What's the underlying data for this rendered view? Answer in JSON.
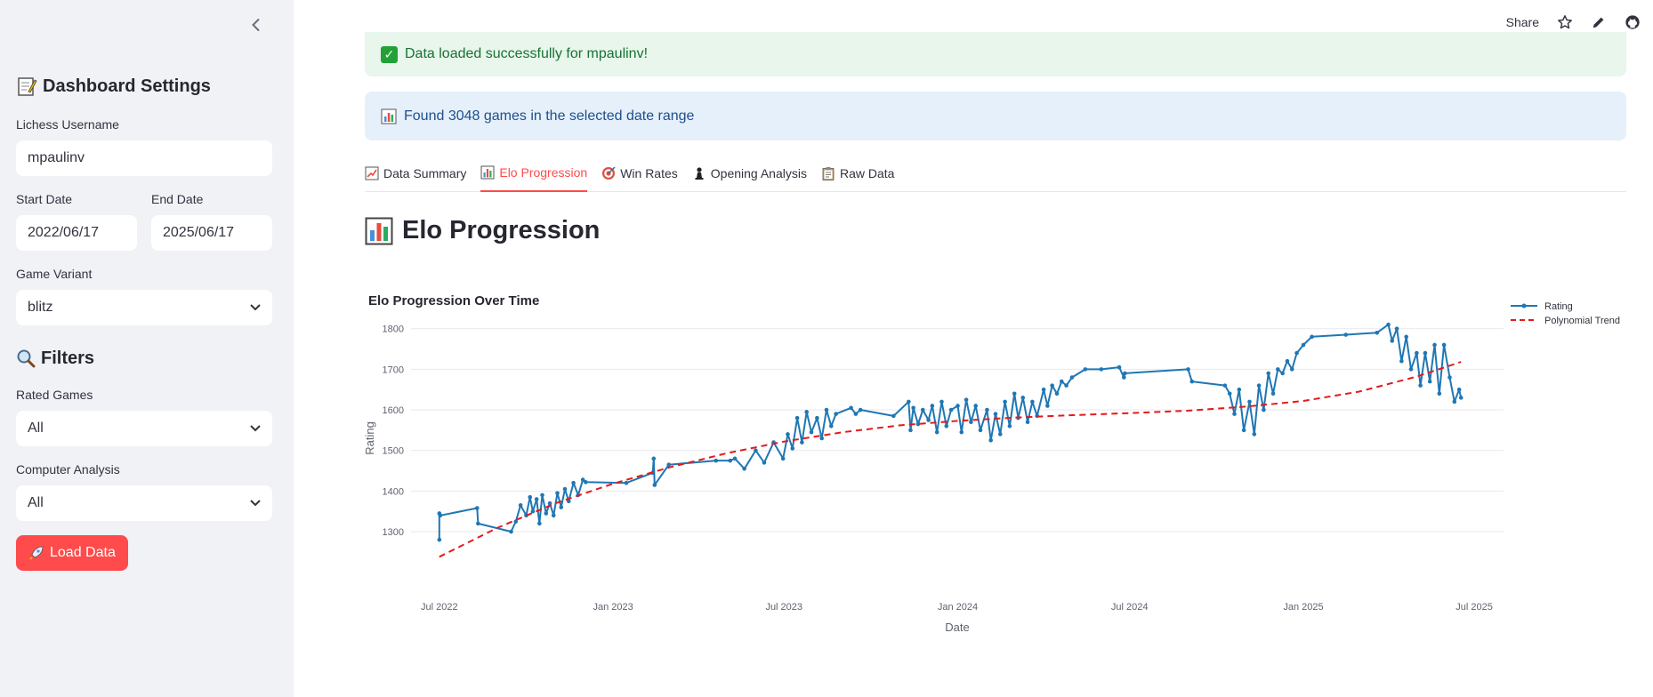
{
  "sidebar": {
    "heading": "Dashboard Settings",
    "username_label": "Lichess Username",
    "username_value": "mpaulinv",
    "start_date_label": "Start Date",
    "start_date_value": "2022/06/17",
    "end_date_label": "End Date",
    "end_date_value": "2025/06/17",
    "variant_label": "Game Variant",
    "variant_value": "blitz",
    "filters_heading": "Filters",
    "rated_label": "Rated Games",
    "rated_value": "All",
    "analysis_label": "Computer Analysis",
    "analysis_value": "All",
    "load_button": "Load Data"
  },
  "topbar": {
    "share_label": "Share"
  },
  "alerts": {
    "success": "Data loaded successfully for mpaulinv!",
    "info": "Found 3048 games in the selected date range"
  },
  "tabs": [
    {
      "label": "Data Summary",
      "icon": "chart-up-icon"
    },
    {
      "label": "Elo Progression",
      "icon": "bar-chart-icon",
      "active": true
    },
    {
      "label": "Win Rates",
      "icon": "target-icon"
    },
    {
      "label": "Opening Analysis",
      "icon": "pawn-icon"
    },
    {
      "label": "Raw Data",
      "icon": "clipboard-icon"
    }
  ],
  "page_title": "Elo Progression",
  "colors": {
    "accent": "#ff4b4b",
    "rating_line": "#1f77b4",
    "trend_line": "#e31a1c"
  },
  "chart_data": {
    "type": "line",
    "title": "Elo Progression Over Time",
    "xlabel": "Date",
    "ylabel": "Rating",
    "x_ticks": [
      "Jul 2022",
      "Jan 2023",
      "Jul 2023",
      "Jan 2024",
      "Jul 2024",
      "Jan 2025",
      "Jul 2025"
    ],
    "y_ticks": [
      1300,
      1400,
      1500,
      1600,
      1700,
      1800
    ],
    "xlim": [
      "2022-06-01",
      "2025-08-01"
    ],
    "ylim": [
      1230,
      1830
    ],
    "grid": true,
    "legend_position": "top-right",
    "series": [
      {
        "name": "Rating",
        "style": "line+markers",
        "x": [
          "2022-07-01",
          "2022-07-01",
          "2022-07-02",
          "2022-08-10",
          "2022-08-11",
          "2022-09-15",
          "2022-09-20",
          "2022-09-25",
          "2022-10-01",
          "2022-10-05",
          "2022-10-08",
          "2022-10-12",
          "2022-10-15",
          "2022-10-18",
          "2022-10-22",
          "2022-10-26",
          "2022-10-30",
          "2022-11-03",
          "2022-11-07",
          "2022-11-11",
          "2022-11-15",
          "2022-11-20",
          "2022-11-25",
          "2022-11-30",
          "2022-12-03",
          "2023-01-15",
          "2023-02-12",
          "2023-02-13",
          "2023-02-14",
          "2023-03-01",
          "2023-04-20",
          "2023-05-05",
          "2023-05-10",
          "2023-05-20",
          "2023-06-01",
          "2023-06-10",
          "2023-06-20",
          "2023-06-30",
          "2023-07-05",
          "2023-07-10",
          "2023-07-15",
          "2023-07-20",
          "2023-07-25",
          "2023-07-30",
          "2023-08-05",
          "2023-08-10",
          "2023-08-15",
          "2023-08-20",
          "2023-08-25",
          "2023-09-10",
          "2023-09-15",
          "2023-09-20",
          "2023-10-25",
          "2023-11-10",
          "2023-11-12",
          "2023-11-15",
          "2023-11-20",
          "2023-11-25",
          "2023-12-01",
          "2023-12-05",
          "2023-12-10",
          "2023-12-15",
          "2023-12-20",
          "2023-12-25",
          "2024-01-01",
          "2024-01-05",
          "2024-01-10",
          "2024-01-15",
          "2024-01-20",
          "2024-01-25",
          "2024-02-01",
          "2024-02-05",
          "2024-02-10",
          "2024-02-15",
          "2024-02-20",
          "2024-02-25",
          "2024-03-01",
          "2024-03-05",
          "2024-03-10",
          "2024-03-15",
          "2024-03-20",
          "2024-03-25",
          "2024-04-01",
          "2024-04-05",
          "2024-04-10",
          "2024-04-15",
          "2024-04-20",
          "2024-04-25",
          "2024-05-01",
          "2024-05-15",
          "2024-06-01",
          "2024-06-20",
          "2024-06-25",
          "2024-06-26",
          "2024-09-01",
          "2024-09-05",
          "2024-10-10",
          "2024-10-15",
          "2024-10-20",
          "2024-10-25",
          "2024-10-30",
          "2024-11-05",
          "2024-11-10",
          "2024-11-15",
          "2024-11-20",
          "2024-11-25",
          "2024-11-30",
          "2024-12-05",
          "2024-12-10",
          "2024-12-15",
          "2024-12-20",
          "2024-12-25",
          "2025-01-01",
          "2025-01-10",
          "2025-02-15",
          "2025-03-20",
          "2025-04-01",
          "2025-04-05",
          "2025-04-10",
          "2025-04-15",
          "2025-04-20",
          "2025-04-25",
          "2025-05-01",
          "2025-05-05",
          "2025-05-10",
          "2025-05-15",
          "2025-05-20",
          "2025-05-25",
          "2025-05-30",
          "2025-06-05",
          "2025-06-10",
          "2025-06-15",
          "2025-06-17"
        ],
        "y": [
          1280,
          1345,
          1340,
          1358,
          1320,
          1300,
          1325,
          1365,
          1340,
          1385,
          1350,
          1380,
          1320,
          1390,
          1345,
          1370,
          1340,
          1395,
          1360,
          1405,
          1375,
          1420,
          1390,
          1428,
          1422,
          1420,
          1445,
          1480,
          1415,
          1465,
          1475,
          1475,
          1480,
          1455,
          1500,
          1470,
          1520,
          1480,
          1540,
          1505,
          1580,
          1520,
          1595,
          1545,
          1580,
          1530,
          1600,
          1560,
          1590,
          1605,
          1590,
          1600,
          1585,
          1620,
          1550,
          1605,
          1565,
          1600,
          1575,
          1610,
          1545,
          1620,
          1560,
          1600,
          1610,
          1545,
          1625,
          1570,
          1610,
          1550,
          1600,
          1525,
          1590,
          1540,
          1620,
          1560,
          1640,
          1580,
          1630,
          1570,
          1620,
          1585,
          1650,
          1610,
          1660,
          1640,
          1670,
          1660,
          1680,
          1700,
          1700,
          1705,
          1680,
          1690,
          1700,
          1670,
          1660,
          1640,
          1590,
          1650,
          1550,
          1620,
          1540,
          1660,
          1600,
          1690,
          1640,
          1700,
          1690,
          1720,
          1700,
          1740,
          1760,
          1780,
          1785,
          1790,
          1810,
          1770,
          1800,
          1720,
          1780,
          1700,
          1740,
          1660,
          1740,
          1670,
          1760,
          1640,
          1760,
          1680,
          1620,
          1650,
          1630
        ]
      },
      {
        "name": "Polynomial Trend",
        "style": "dash",
        "x": [
          "2022-07-01",
          "2022-09-01",
          "2022-11-01",
          "2023-01-01",
          "2023-03-01",
          "2023-05-01",
          "2023-07-01",
          "2023-09-01",
          "2023-11-01",
          "2024-01-01",
          "2024-03-01",
          "2024-05-01",
          "2024-07-01",
          "2024-09-01",
          "2024-11-01",
          "2025-01-01",
          "2025-03-01",
          "2025-05-01",
          "2025-06-17"
        ],
        "y": [
          1238,
          1310,
          1370,
          1418,
          1458,
          1493,
          1522,
          1545,
          1562,
          1573,
          1581,
          1587,
          1592,
          1598,
          1608,
          1622,
          1645,
          1682,
          1718
        ]
      }
    ]
  }
}
